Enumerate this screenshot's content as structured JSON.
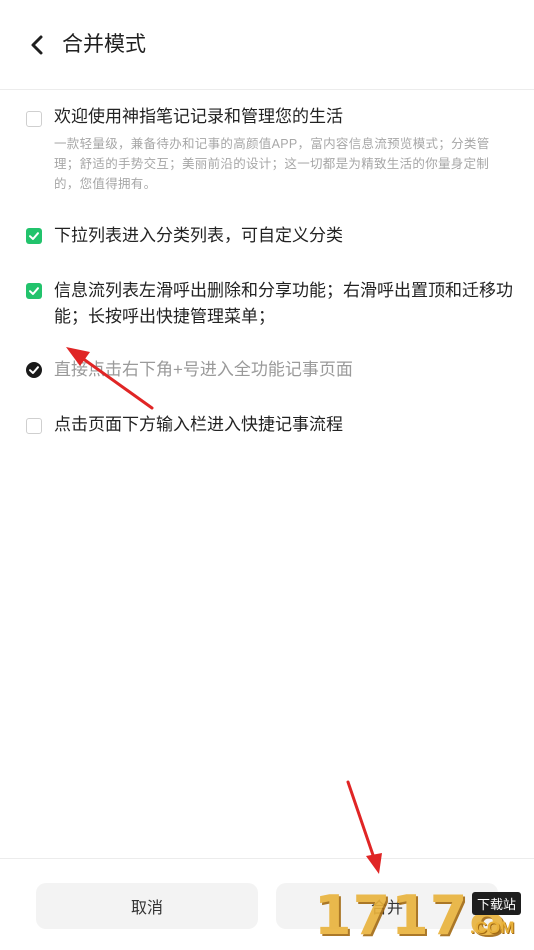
{
  "header": {
    "title": "合并模式"
  },
  "items": [
    {
      "state": "unchecked",
      "label": "欢迎使用神指笔记记录和管理您的生活",
      "description": "一款轻量级，兼备待办和记事的高颜值APP，富内容信息流预览模式；分类管理；舒适的手势交互；美丽前沿的设计；这一切都是为精致生活的你量身定制的，您值得拥有。"
    },
    {
      "state": "checked",
      "label": "下拉列表进入分类列表，可自定义分类"
    },
    {
      "state": "checked",
      "label": "信息流列表左滑呼出删除和分享功能；右滑呼出置顶和迁移功能；长按呼出快捷管理菜单；"
    },
    {
      "state": "checked-dark",
      "label": "直接点击右下角+号进入全功能记事页面"
    },
    {
      "state": "unchecked",
      "label": "点击页面下方输入栏进入快捷记事流程"
    }
  ],
  "footer": {
    "cancel_label": "取消",
    "merge_label": "合并"
  },
  "watermark": {
    "number": "17178",
    "tag": "下载站",
    "domain": ".COM"
  },
  "colors": {
    "accent": "#22c36c",
    "dark_check": "#1a1a1a",
    "arrow": "#e02525",
    "watermark": "#e9b23a"
  }
}
